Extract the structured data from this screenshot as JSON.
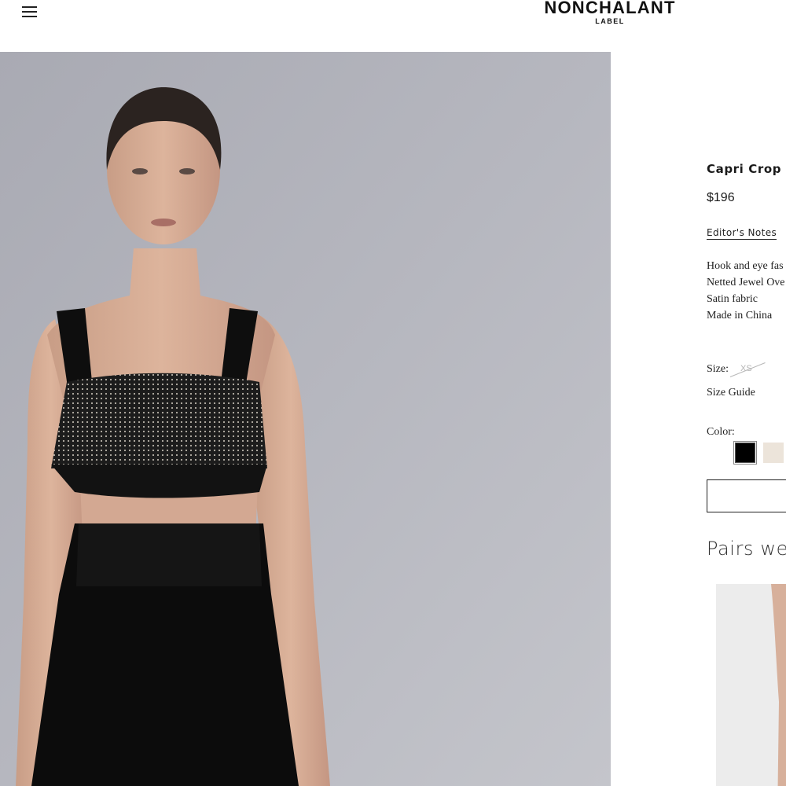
{
  "header": {
    "brand_name": "NONCHALANT",
    "brand_sub": "LABEL"
  },
  "product": {
    "title": "Capri Crop",
    "price": "$196",
    "editors_notes_label": "Editor's Notes",
    "details": [
      "Hook and eye fas",
      "Netted Jewel Ove",
      "Satin fabric",
      "Made in China"
    ],
    "size_label": "Size:",
    "size_options": [
      "XS"
    ],
    "size_guide_label": "Size Guide",
    "color_label": "Color:",
    "colors": [
      {
        "name": "black",
        "hex": "#000000"
      },
      {
        "name": "cream",
        "hex": "#ece4da"
      }
    ]
  },
  "recommendations": {
    "heading": "Pairs we"
  },
  "colors": {
    "image_background": "#b3b4bb",
    "text": "#1a1a1a"
  }
}
